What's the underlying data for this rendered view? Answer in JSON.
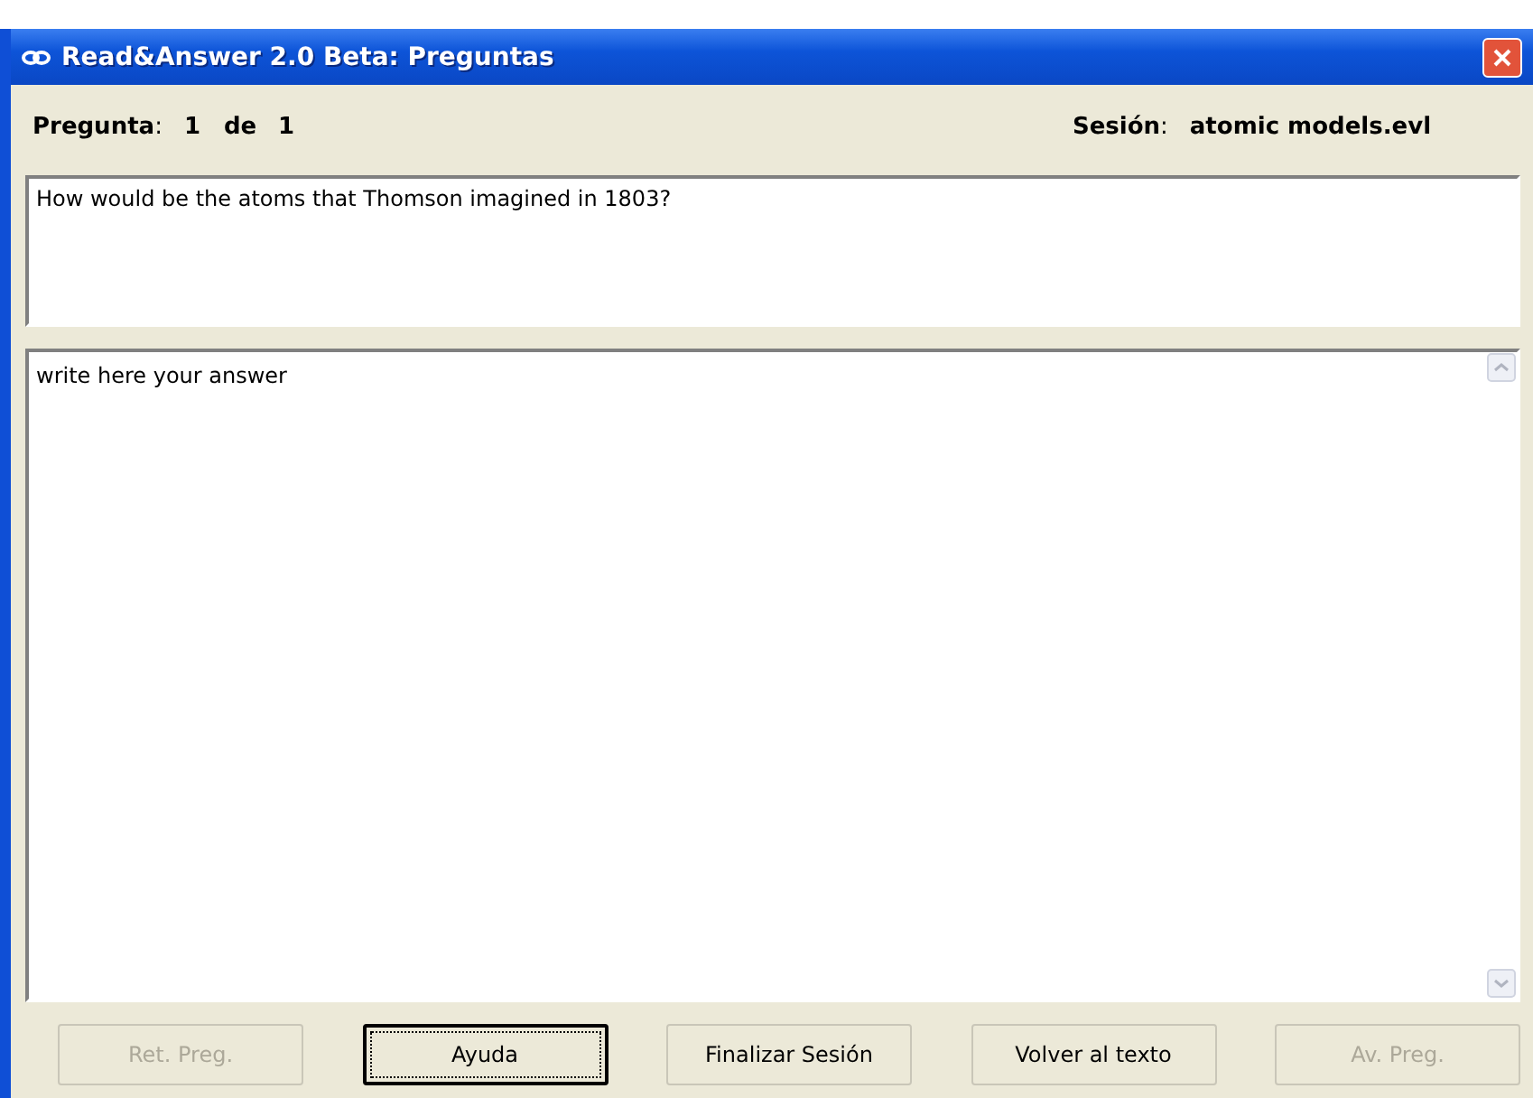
{
  "window": {
    "title": "Read&Answer 2.0 Beta: Preguntas"
  },
  "info": {
    "question_label": "Pregunta",
    "colon": ":",
    "question_number": "1",
    "of": "de",
    "question_total": "1",
    "session_label": "Sesión",
    "session_colon": ":",
    "session_name": "atomic models.evl"
  },
  "question": {
    "text": "How would be the atoms  that Thomson imagined in 1803?"
  },
  "answer": {
    "value": "write here your answer"
  },
  "buttons": [
    {
      "label": "Ret. Preg.",
      "disabled": true,
      "focused": false
    },
    {
      "label": "Ayuda",
      "disabled": false,
      "focused": true
    },
    {
      "label": "Finalizar Sesión",
      "disabled": false,
      "focused": false
    },
    {
      "label": "Volver al texto",
      "disabled": false,
      "focused": false
    },
    {
      "label": "Av. Preg.",
      "disabled": true,
      "focused": false
    }
  ]
}
